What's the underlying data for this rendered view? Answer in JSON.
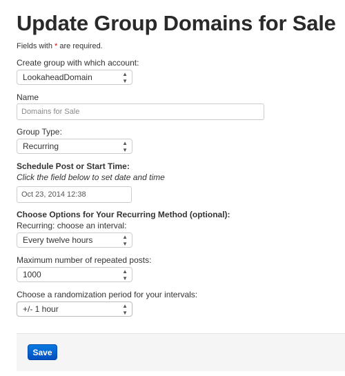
{
  "title": "Update Group Domains for Sale",
  "required_note": {
    "prefix": "Fields with ",
    "star": "*",
    "suffix": " are required."
  },
  "account": {
    "label": "Create group with which account:",
    "value": "LookaheadDomain"
  },
  "name": {
    "label": "Name",
    "value": "Domains for Sale"
  },
  "group_type": {
    "label": "Group Type:",
    "value": "Recurring"
  },
  "schedule": {
    "label": "Schedule Post or Start Time:",
    "hint": "Click the field below to set date and time",
    "value": "Oct 23, 2014 12:38"
  },
  "recurring": {
    "heading": "Choose Options for Your Recurring Method (optional):",
    "interval_label": "Recurring: choose an interval:",
    "interval_value": "Every twelve hours",
    "max_label": "Maximum number of repeated posts:",
    "max_value": "1000",
    "random_label": "Choose a randomization period for your intervals:",
    "random_value": "+/- 1 hour"
  },
  "footer": {
    "save_label": "Save",
    "accent": "#0a6ad6"
  }
}
